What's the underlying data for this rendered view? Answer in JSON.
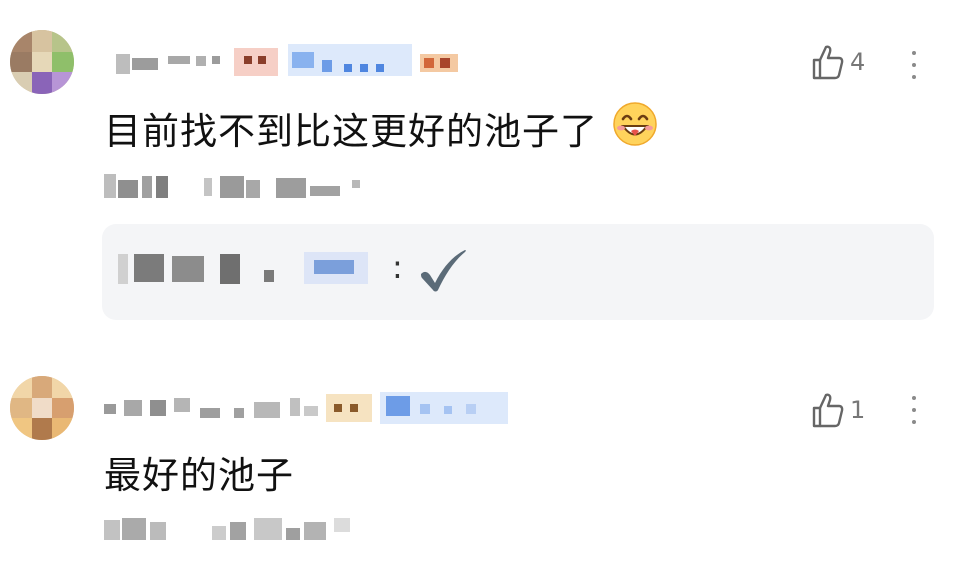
{
  "comments": [
    {
      "likes": "4",
      "text": "目前找不到比这更好的池子了",
      "emoji": "smiling-face-icon",
      "reply": {
        "colon": ":"
      }
    },
    {
      "likes": "1",
      "text": "最好的池子"
    }
  ]
}
